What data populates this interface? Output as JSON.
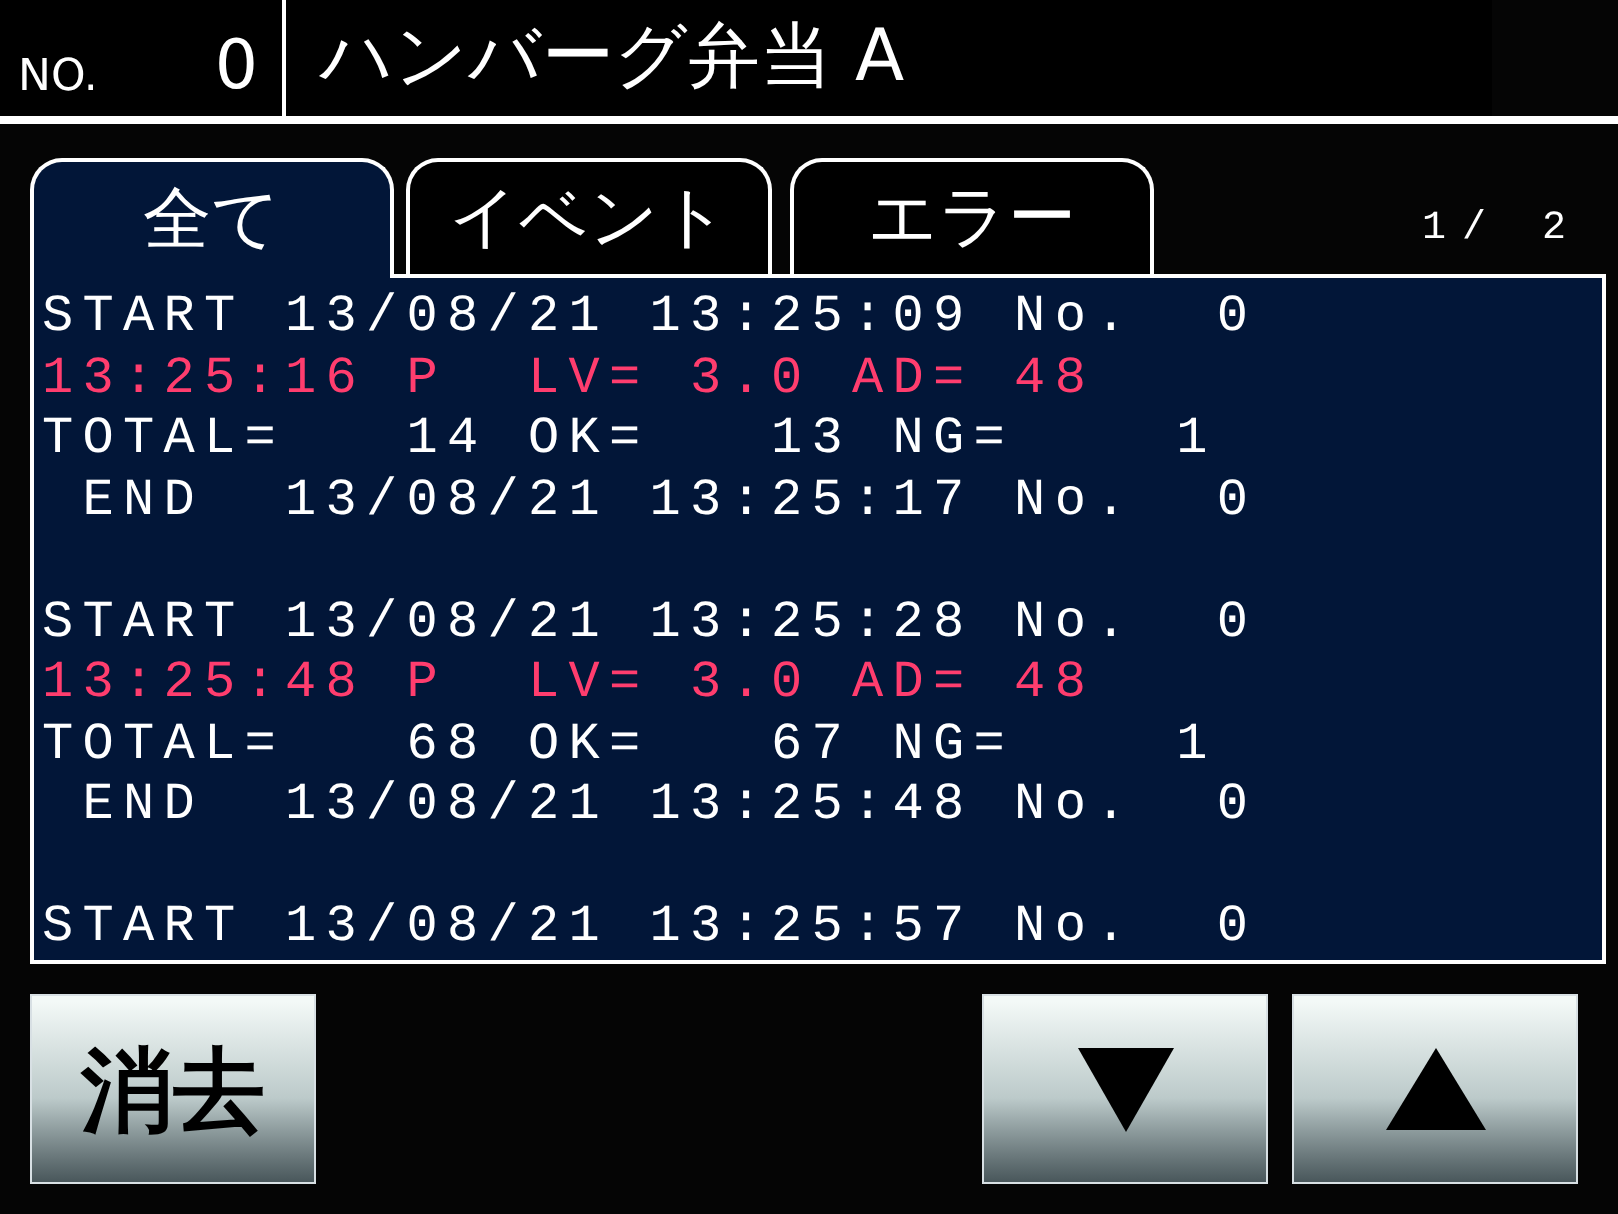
{
  "header": {
    "number_label": "NO.",
    "number": "0",
    "title": "ハンバーグ弁当 A"
  },
  "tabs": [
    {
      "label": "全て",
      "selected": true
    },
    {
      "label": "イベント",
      "selected": false
    },
    {
      "label": "エラー",
      "selected": false
    }
  ],
  "page_indicator": "1/ 2",
  "log": [
    {
      "lines": [
        {
          "kind": "start",
          "text": "START 13/08/21 13:25:09 No.  0"
        },
        {
          "kind": "measurement",
          "text": "13:25:16 P  LV= 3.0 AD= 48"
        },
        {
          "kind": "total",
          "text": "TOTAL=   14 OK=   13 NG=    1"
        },
        {
          "kind": "end",
          "text": " END  13/08/21 13:25:17 No.  0"
        }
      ]
    },
    {
      "lines": [
        {
          "kind": "start",
          "text": "START 13/08/21 13:25:28 No.  0"
        },
        {
          "kind": "measurement",
          "text": "13:25:48 P  LV= 3.0 AD= 48"
        },
        {
          "kind": "total",
          "text": "TOTAL=   68 OK=   67 NG=    1"
        },
        {
          "kind": "end",
          "text": " END  13/08/21 13:25:48 No.  0"
        }
      ]
    },
    {
      "lines": [
        {
          "kind": "start",
          "text": "START 13/08/21 13:25:57 No.  0"
        }
      ]
    }
  ],
  "buttons": [
    {
      "kind": "label",
      "label": "消去"
    },
    {
      "kind": "down"
    },
    {
      "kind": "up"
    }
  ]
}
